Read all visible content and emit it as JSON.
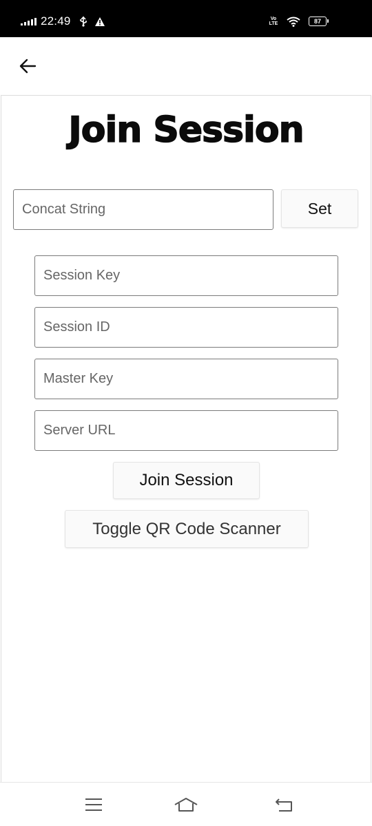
{
  "status_bar": {
    "time": "22:49",
    "volte": "Vo LTE",
    "battery": "87"
  },
  "app_bar": {
    "back_icon": "arrow-left-icon"
  },
  "main": {
    "title": "Join Session",
    "concat": {
      "placeholder": "Concat String",
      "value": "",
      "set_label": "Set"
    },
    "fields": [
      {
        "placeholder": "Session Key",
        "value": ""
      },
      {
        "placeholder": "Session ID",
        "value": ""
      },
      {
        "placeholder": "Master Key",
        "value": ""
      },
      {
        "placeholder": "Server URL",
        "value": ""
      }
    ],
    "join_label": "Join Session",
    "qr_label": "Toggle QR Code Scanner"
  },
  "nav_bar": {
    "icons": [
      "menu-icon",
      "home-icon",
      "back-icon"
    ]
  },
  "colors": {
    "status_bar_bg": "#000000",
    "input_border": "#7a7a7a",
    "button_bg": "#fafafa",
    "title": "#0b0b0b"
  }
}
